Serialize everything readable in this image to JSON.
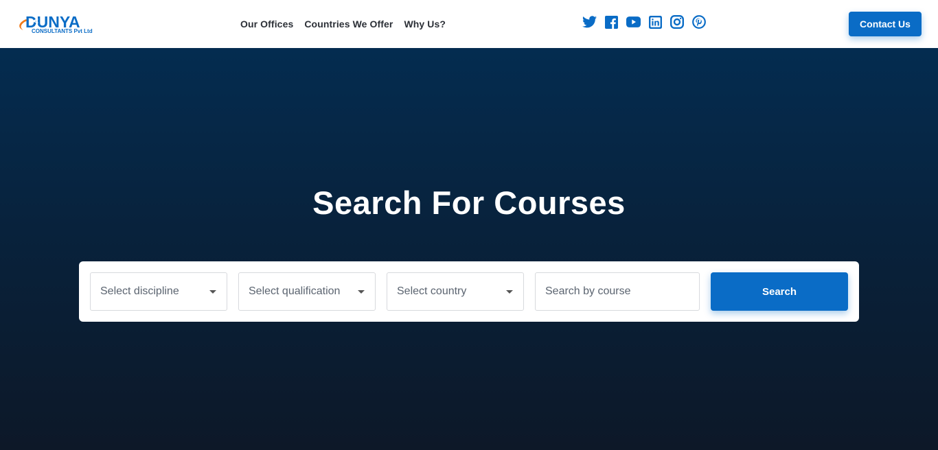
{
  "brand": {
    "name": "DUNYA",
    "tagline": "CONSULTANTS Pvt Ltd",
    "primary_color": "#0a6cc6",
    "accent_color": "#f07a1a"
  },
  "nav": {
    "links": [
      "Our Offices",
      "Countries We Offer",
      "Why Us?"
    ],
    "contact_label": "Contact Us"
  },
  "socials": [
    "twitter-icon",
    "facebook-icon",
    "youtube-icon",
    "linkedin-icon",
    "instagram-icon",
    "pinterest-icon"
  ],
  "hero": {
    "title": "Search For Courses"
  },
  "search": {
    "discipline_placeholder": "Select discipline",
    "qualification_placeholder": "Select qualification",
    "country_placeholder": "Select country",
    "course_placeholder": "Search by course",
    "button_label": "Search"
  }
}
